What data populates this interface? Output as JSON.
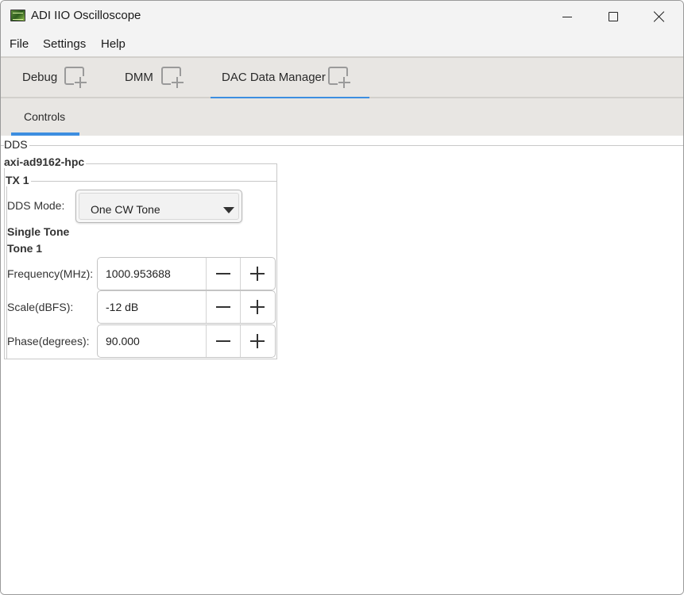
{
  "window": {
    "title": "ADI IIO Oscilloscope"
  },
  "menu": {
    "items": [
      "File",
      "Settings",
      "Help"
    ]
  },
  "main_tabs": [
    {
      "label": "Debug",
      "active": false
    },
    {
      "label": "DMM",
      "active": false
    },
    {
      "label": "DAC Data Manager",
      "active": true
    }
  ],
  "sub_tabs": [
    {
      "label": "Controls",
      "active": true
    }
  ],
  "dds": {
    "section_label": "DDS",
    "device_label": "axi-ad9162-hpc",
    "channel_label": "TX 1",
    "mode_label": "DDS Mode:",
    "mode_value": "One CW Tone",
    "single_tone_label": "Single Tone",
    "tone_label": "Tone 1",
    "fields": [
      {
        "label": "Frequency(MHz):",
        "value": "1000.953688"
      },
      {
        "label": "Scale(dBFS):",
        "value": "-12 dB"
      },
      {
        "label": "Phase(degrees):",
        "value": "90.000"
      }
    ]
  },
  "colors": {
    "accent": "#3d8ee0",
    "tabbar_bg": "#e8e6e3",
    "titlebar_bg": "#f3f3f3"
  },
  "icons": {
    "app": "adi-iio-oscilloscope-icon",
    "tab_detach": "add-window-icon",
    "dropdown": "triangle-down-icon",
    "decrement": "minus-icon",
    "increment": "plus-icon"
  }
}
